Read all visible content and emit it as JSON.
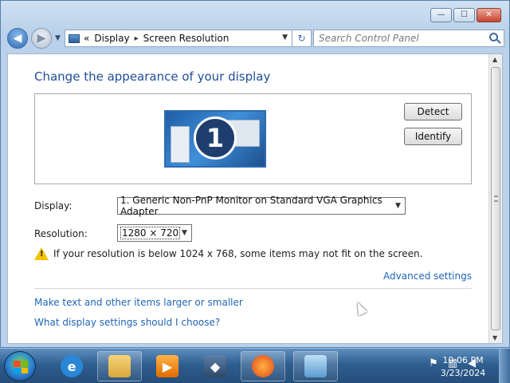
{
  "window": {
    "buttons": {
      "minimize_glyph": "—",
      "maximize_glyph": "☐",
      "close_glyph": "✕"
    }
  },
  "navigation": {
    "back_glyph": "◀",
    "forward_glyph": "▶",
    "breadcrumb": {
      "overflow": "«",
      "items": [
        "Display",
        "Screen Resolution"
      ],
      "separator": "▸"
    },
    "refresh_glyph": "↻",
    "search_placeholder": "Search Control Panel"
  },
  "page": {
    "title": "Change the appearance of your display",
    "monitor_number": "1",
    "detect_label": "Detect",
    "identify_label": "Identify",
    "display_label": "Display:",
    "display_value": "1. Generic Non-PnP Monitor on Standard VGA Graphics Adapter",
    "resolution_label": "Resolution:",
    "resolution_value": "1280 × 720",
    "warning_text": "If your resolution is below 1024 x 768, some items may not fit on the screen.",
    "advanced_link": "Advanced settings",
    "larger_link": "Make text and other items larger or smaller",
    "which_link": "What display settings should I choose?"
  },
  "taskbar": {
    "pinned_items": [
      "internet-explorer",
      "windows-explorer",
      "media-player",
      "virtualbox",
      "firefox",
      "control-panel-screen-resolution"
    ],
    "clock_time": "10:06 PM",
    "clock_date": "3/23/2024"
  },
  "colors": {
    "link": "#1f65b8",
    "title": "#1f4e97",
    "taskbar": "#2f5e8f"
  }
}
